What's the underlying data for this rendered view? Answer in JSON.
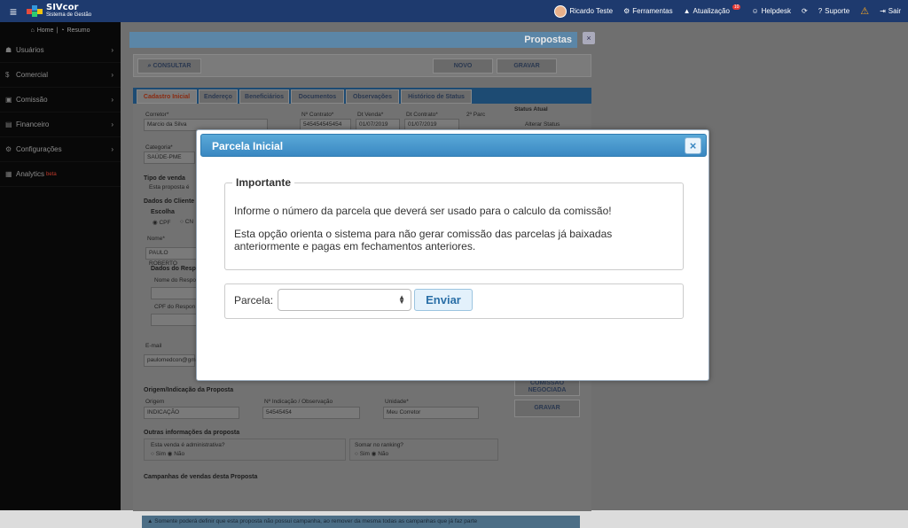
{
  "topbar": {
    "logo_title": "SIVcor",
    "logo_subtitle": "Sistema de Gestão",
    "user_name": "Ricardo Teste",
    "ferramentas": "Ferramentas",
    "atualizacao": "Atualização",
    "atualizacao_badge": "10",
    "helpdesk": "Helpdesk",
    "suporte": "Suporte",
    "sair": "Sair"
  },
  "sidebar": {
    "home": "Home",
    "resumo": "Resumo",
    "items": [
      {
        "label": "Usuários"
      },
      {
        "label": "Comercial"
      },
      {
        "label": "Comissão"
      },
      {
        "label": "Financeiro"
      },
      {
        "label": "Configurações"
      },
      {
        "label": "Analytics",
        "badge": "beta"
      }
    ]
  },
  "page": {
    "title": "Propostas",
    "close": "×",
    "consultar": "CONSULTAR",
    "novo": "NOVO",
    "gravar": "GRAVAR",
    "tabs": [
      "Cadastro Inicial",
      "Endereço",
      "Beneficiários",
      "Documentos",
      "Observações",
      "Histórico de Status"
    ],
    "corretor_label": "Corretor*",
    "corretor_value": "Marcio da Silva",
    "contrato_label": "Nº Contrato*",
    "contrato_value": "545454545454",
    "dtvenda_label": "Dt Venda*",
    "dtvenda_value": "01/07/2019",
    "dtcontrato_label": "Dt Contrato*",
    "dtcontrato_value": "01/07/2019",
    "parc_label": "2º Parc",
    "status_label": "Status Atual",
    "alterar_status": "Alterar Status",
    "categoria_label": "Categoria*",
    "categoria_value": "SAÚDE-PME",
    "tipo_venda": "Tipo de venda",
    "tipo_venda_opt": "Esta proposta é",
    "dados_cliente": "Dados do Cliente",
    "escolha": "Escolha",
    "cpf": "CPF",
    "cnpj": "CN",
    "nome_label": "Nome*",
    "nome_value": "PAULO ROBERTO",
    "dados_resp": "Dados do Resp",
    "nome_resp": "Nome do Respo",
    "cpf_resp": "CPF do Respon",
    "email_label": "E-mail",
    "email_value": "paulomedcon@gm",
    "comissao_btn": "COMISSÃO NEGOCIADA",
    "gravar2": "GRAVAR",
    "origem_sec": "Origem/Indicação da Proposta",
    "origem_label": "Origem",
    "origem_value": "INDICAÇÃO",
    "indicacao_label": "Nº Indicação / Observação",
    "indicacao_value": "54545454",
    "unidade_label": "Unidade*",
    "unidade_value": "Meu Corretor",
    "outras_sec": "Outras informações da proposta",
    "admin_q": "Esta venda é administrativa?",
    "ranking_q": "Somar no ranking?",
    "sim": "Sim",
    "nao": "Não",
    "campanhas_sec": "Campanhas de vendas desta Proposta",
    "alert": "Somente poderá definir que esta proposta não possui campanha, ao remover da mesma todas as campanhas que já faz parte"
  },
  "modal": {
    "title": "Parcela Inicial",
    "close": "×",
    "legend": "Importante",
    "p1": "Informe o número da parcela que deverá ser usado para o calculo da comissão!",
    "p2": "Esta opção orienta o sistema para não gerar comissão das parcelas já baixadas anteriormente e pagas em fechamentos anteriores.",
    "parcela_label": "Parcela:",
    "parcela_value": "",
    "enviar": "Enviar"
  }
}
